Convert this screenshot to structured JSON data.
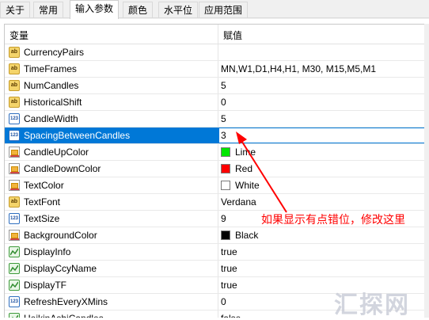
{
  "tabs": [
    {
      "label": "关于",
      "active": false
    },
    {
      "label": "常用",
      "active": false
    },
    {
      "label": "输入参数",
      "active": true
    },
    {
      "label": "颜色",
      "active": false
    },
    {
      "label": "水平位",
      "active": false
    },
    {
      "label": "应用范围",
      "active": false
    }
  ],
  "table": {
    "header": {
      "name": "变量",
      "value": "赋值"
    },
    "rows": [
      {
        "name": "CurrencyPairs",
        "value": "",
        "icon": "ab"
      },
      {
        "name": "TimeFrames",
        "value": "MN,W1,D1,H4,H1, M30, M15,M5,M1",
        "icon": "ab"
      },
      {
        "name": "NumCandles",
        "value": "5",
        "icon": "ab"
      },
      {
        "name": "HistoricalShift",
        "value": "0",
        "icon": "ab"
      },
      {
        "name": "CandleWidth",
        "value": "5",
        "icon": "num"
      },
      {
        "name": "SpacingBetweenCandles",
        "value": "3",
        "icon": "num",
        "selected": true
      },
      {
        "name": "CandleUpColor",
        "value": "Lime",
        "icon": "color",
        "swatch": "#00e600"
      },
      {
        "name": "CandleDownColor",
        "value": "Red",
        "icon": "color",
        "swatch": "#ff0000"
      },
      {
        "name": "TextColor",
        "value": "White",
        "icon": "color",
        "swatch": "#ffffff"
      },
      {
        "name": "TextFont",
        "value": "Verdana",
        "icon": "ab"
      },
      {
        "name": "TextSize",
        "value": "9",
        "icon": "num"
      },
      {
        "name": "BackgroundColor",
        "value": "Black",
        "icon": "color",
        "swatch": "#000000"
      },
      {
        "name": "DisplayInfo",
        "value": "true",
        "icon": "bool"
      },
      {
        "name": "DisplayCcyName",
        "value": "true",
        "icon": "bool"
      },
      {
        "name": "DisplayTF",
        "value": "true",
        "icon": "bool"
      },
      {
        "name": "RefreshEveryXMins",
        "value": "0",
        "icon": "num"
      },
      {
        "name": "HeikinAshiCandles",
        "value": "false",
        "icon": "bool"
      }
    ]
  },
  "icon_text": {
    "ab": "ab",
    "num": "123"
  },
  "annotation": "如果显示有点错位，修改这里",
  "watermark": "汇探网",
  "colors": {
    "selection": "#0078d7",
    "annotation": "#ff0000"
  }
}
